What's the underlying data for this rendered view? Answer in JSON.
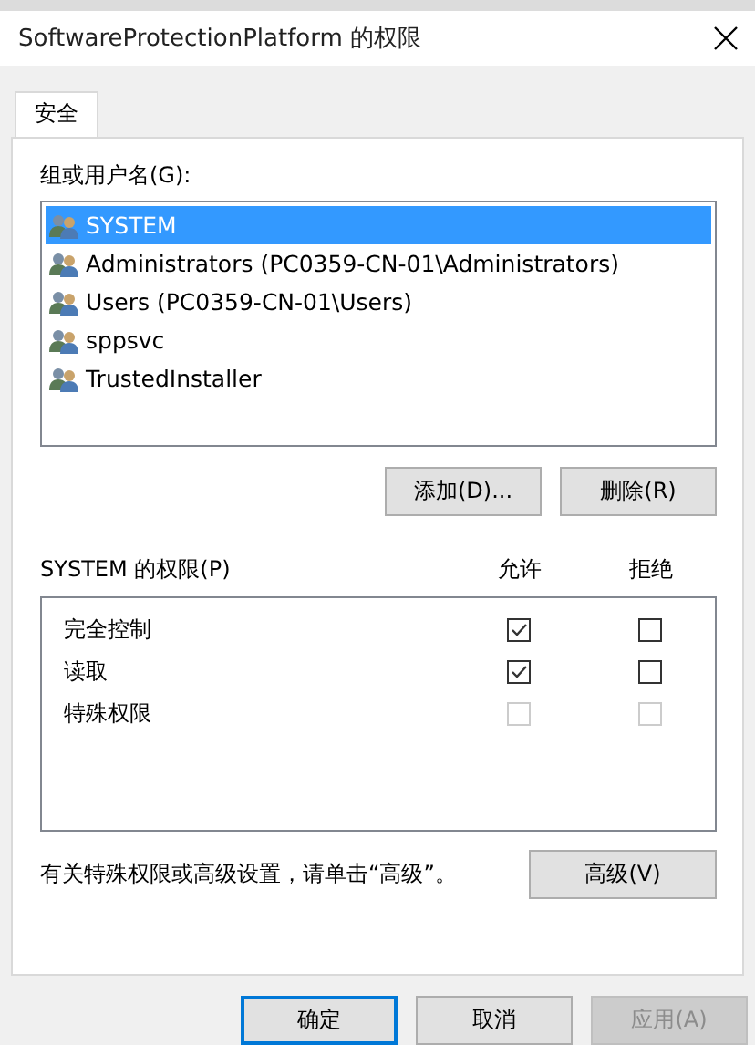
{
  "window": {
    "title": "SoftwareProtectionPlatform 的权限"
  },
  "tabs": [
    {
      "label": "安全",
      "selected": true
    }
  ],
  "users": {
    "label": "组或用户名(G):",
    "items": [
      {
        "name": "SYSTEM",
        "selected": true
      },
      {
        "name": "Administrators (PC0359-CN-01\\Administrators)",
        "selected": false
      },
      {
        "name": "Users (PC0359-CN-01\\Users)",
        "selected": false
      },
      {
        "name": "sppsvc",
        "selected": false
      },
      {
        "name": "TrustedInstaller",
        "selected": false
      }
    ],
    "buttons": [
      {
        "label": "添加(D)...",
        "disabled": false
      },
      {
        "label": "删除(R)",
        "disabled": false
      }
    ]
  },
  "permissions": {
    "label": "SYSTEM 的权限(P)",
    "columns": [
      "允许",
      "拒绝"
    ],
    "rows": [
      {
        "name": "完全控制",
        "allow": {
          "checked": true,
          "disabled": false
        },
        "deny": {
          "checked": false,
          "disabled": false
        }
      },
      {
        "name": "读取",
        "allow": {
          "checked": true,
          "disabled": false
        },
        "deny": {
          "checked": false,
          "disabled": false
        }
      },
      {
        "name": "特殊权限",
        "allow": {
          "checked": false,
          "disabled": true
        },
        "deny": {
          "checked": false,
          "disabled": true
        }
      }
    ]
  },
  "advanced": {
    "note": "有关特殊权限或高级设置，请单击“高级”。",
    "button": "高级(V)"
  },
  "footer_buttons": [
    {
      "label": "确定",
      "default": true,
      "disabled": false
    },
    {
      "label": "取消",
      "default": false,
      "disabled": false
    },
    {
      "label": "应用(A)",
      "default": false,
      "disabled": true
    }
  ]
}
